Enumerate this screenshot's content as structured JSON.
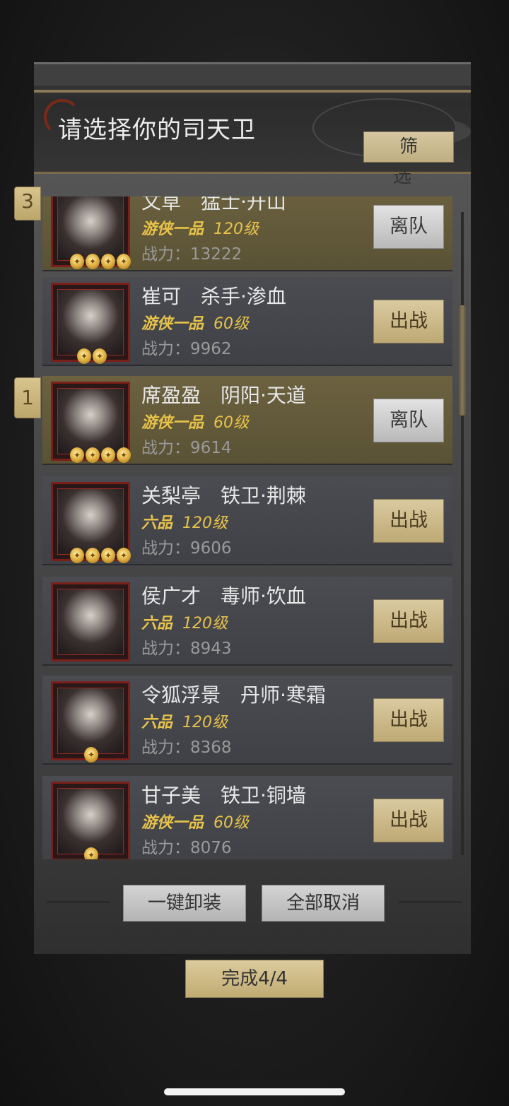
{
  "header": {
    "title": "请选择你的司天卫",
    "filter_label": "筛 选"
  },
  "power_prefix": "战力：",
  "cards": [
    {
      "slot": "3",
      "name": "文草",
      "class": "猛士·开山",
      "grade": "游侠一品",
      "level": "120级",
      "power": "13222",
      "stars": 4,
      "action": "离队",
      "selected": true
    },
    {
      "slot": "",
      "name": "崔可",
      "class": "杀手·渗血",
      "grade": "游侠一品",
      "level": "60级",
      "power": "9962",
      "stars": 2,
      "action": "出战",
      "selected": false
    },
    {
      "slot": "1",
      "name": "席盈盈",
      "class": "阴阳·天道",
      "grade": "游侠一品",
      "level": "60级",
      "power": "9614",
      "stars": 4,
      "action": "离队",
      "selected": true
    },
    {
      "slot": "",
      "name": "关梨亭",
      "class": "铁卫·荆棘",
      "grade": "六品",
      "level": "120级",
      "power": "9606",
      "stars": 4,
      "action": "出战",
      "selected": false
    },
    {
      "slot": "",
      "name": "侯广才",
      "class": "毒师·饮血",
      "grade": "六品",
      "level": "120级",
      "power": "8943",
      "stars": 0,
      "action": "出战",
      "selected": false
    },
    {
      "slot": "",
      "name": "令狐浮景",
      "class": "丹师·寒霜",
      "grade": "六品",
      "level": "120级",
      "power": "8368",
      "stars": 1,
      "action": "出战",
      "selected": false
    },
    {
      "slot": "",
      "name": "甘子美",
      "class": "铁卫·铜墙",
      "grade": "游侠一品",
      "level": "60级",
      "power": "8076",
      "stars": 1,
      "action": "出战",
      "selected": false
    }
  ],
  "footer": {
    "unequip_all": "一键卸装",
    "cancel_all": "全部取消",
    "done": "完成4/4"
  },
  "colors": {
    "accent_gold": "#c9b37a",
    "selected_row": "#625936",
    "grade_text": "#e8c34a",
    "portrait_border": "#7a1f1a"
  }
}
